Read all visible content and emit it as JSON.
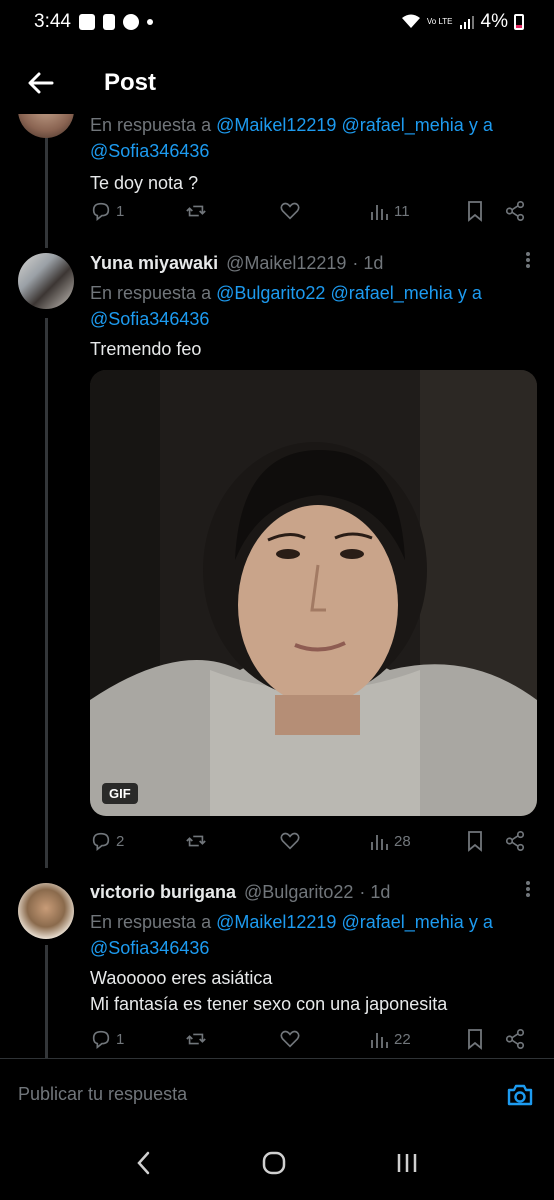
{
  "status_bar": {
    "time": "3:44",
    "battery": "4%",
    "volte": "Vo LTE"
  },
  "header": {
    "title": "Post"
  },
  "tweets": [
    {
      "reply_prefix": "En respuesta a",
      "mentions": [
        "@Maikel12219",
        "@rafael_mehia"
      ],
      "and_text": "y a",
      "last_mention": "@Sofia346436",
      "text": "Te doy nota ?",
      "stats": {
        "replies": "1",
        "reposts": "",
        "likes": "",
        "views": "11"
      }
    },
    {
      "name": "Yuna miyawaki",
      "handle": "@Maikel12219",
      "time": "· 1d",
      "reply_prefix": "En respuesta a",
      "mentions": [
        "@Bulgarito22",
        "@rafael_mehia"
      ],
      "and_text": "y a",
      "last_mention": "@Sofia346436",
      "text": "Tremendo feo",
      "media_badge": "GIF",
      "stats": {
        "replies": "2",
        "reposts": "",
        "likes": "",
        "views": "28"
      }
    },
    {
      "name": "victorio burigana",
      "handle": "@Bulgarito22",
      "time": "· 1d",
      "reply_prefix": "En respuesta a",
      "mentions": [
        "@Maikel12219",
        "@rafael_mehia"
      ],
      "and_text": "y a",
      "last_mention": "@Sofia346436",
      "text_lines": [
        "Waooooo eres asiática",
        "Mi fantasía es tener sexo con una japonesita"
      ],
      "stats": {
        "replies": "1",
        "reposts": "",
        "likes": "",
        "views": "22"
      }
    }
  ],
  "reply_bar": {
    "placeholder": "Publicar tu respuesta"
  },
  "colors": {
    "accent": "#1d9bf0",
    "muted": "#71767b",
    "text": "#e7e9ea",
    "background": "#000000"
  },
  "icons": [
    "back-arrow-icon",
    "reply-icon",
    "repost-icon",
    "like-icon",
    "views-icon",
    "bookmark-icon",
    "share-icon",
    "camera-icon",
    "more-icon"
  ]
}
